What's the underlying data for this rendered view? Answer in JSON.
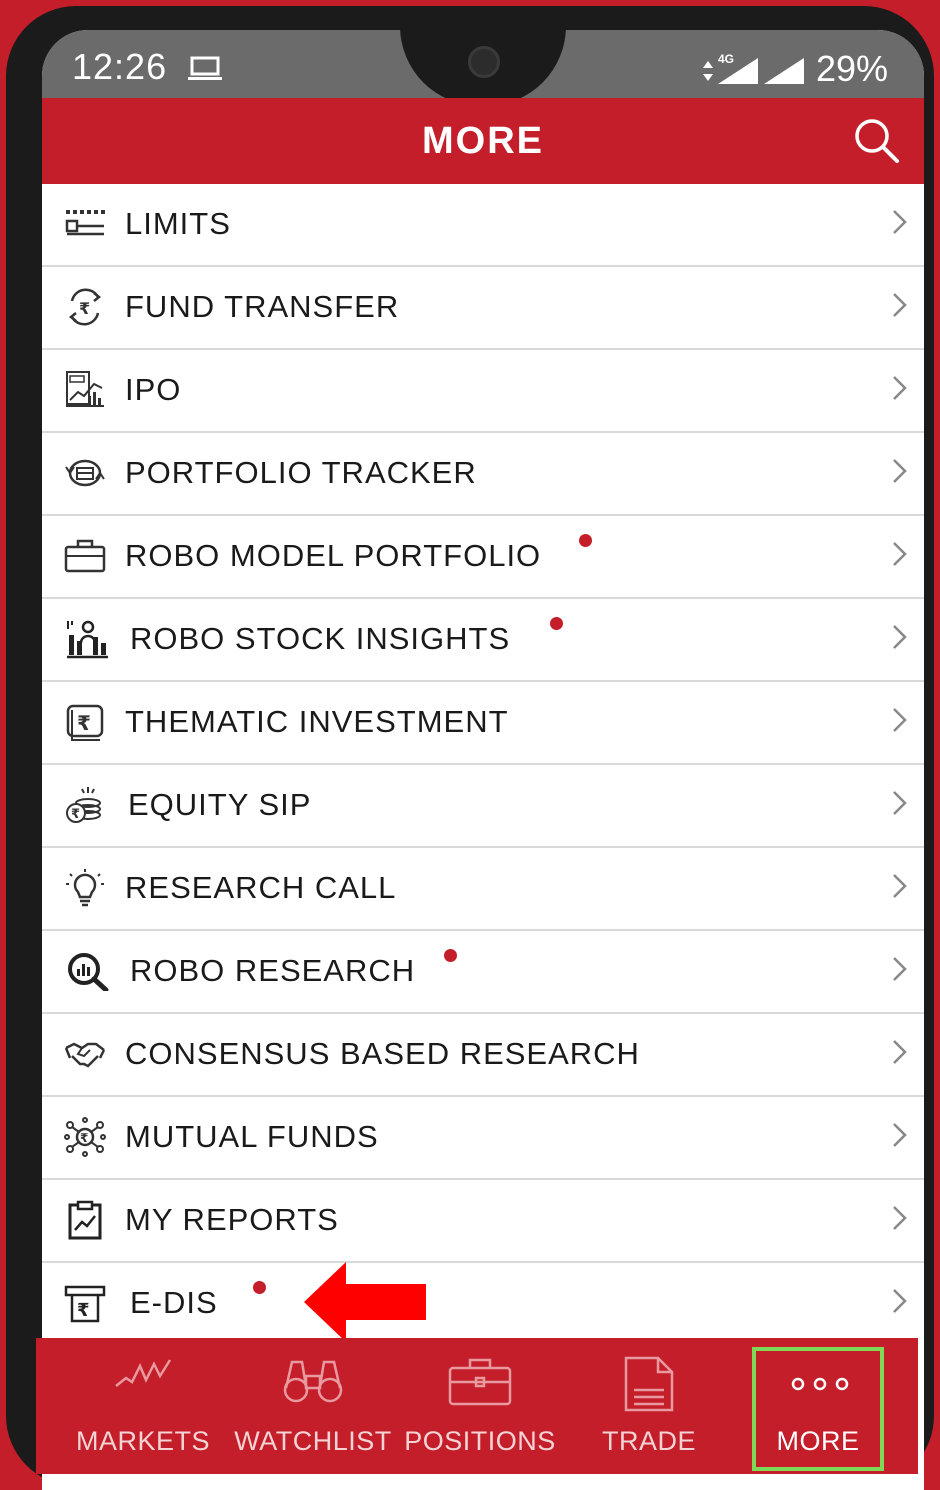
{
  "status_bar": {
    "time": "12:26",
    "network": "4G",
    "battery": "29%"
  },
  "header": {
    "title": "MORE"
  },
  "menu": {
    "items": [
      {
        "label": "LIMITS",
        "icon": "limits-icon",
        "new": false
      },
      {
        "label": "FUND TRANSFER",
        "icon": "fund-transfer-icon",
        "new": false
      },
      {
        "label": "IPO",
        "icon": "ipo-icon",
        "new": false
      },
      {
        "label": "PORTFOLIO TRACKER",
        "icon": "portfolio-tracker-icon",
        "new": false
      },
      {
        "label": "ROBO MODEL PORTFOLIO",
        "icon": "briefcase-icon",
        "new": true
      },
      {
        "label": "ROBO STOCK INSIGHTS",
        "icon": "stock-insights-icon",
        "new": true
      },
      {
        "label": "THEMATIC INVESTMENT",
        "icon": "rupee-note-icon",
        "new": false
      },
      {
        "label": "EQUITY SIP",
        "icon": "coins-icon",
        "new": false
      },
      {
        "label": "RESEARCH CALL",
        "icon": "lightbulb-icon",
        "new": false
      },
      {
        "label": "ROBO RESEARCH",
        "icon": "magnifier-chart-icon",
        "new": true
      },
      {
        "label": "CONSENSUS BASED RESEARCH",
        "icon": "handshake-icon",
        "new": false
      },
      {
        "label": "MUTUAL FUNDS",
        "icon": "network-gear-icon",
        "new": false
      },
      {
        "label": "MY REPORTS",
        "icon": "clipboard-chart-icon",
        "new": false
      },
      {
        "label": "E-DIS",
        "icon": "rupee-receipt-icon",
        "new": true
      }
    ]
  },
  "bottom_nav": {
    "items": [
      {
        "label": "MARKETS",
        "icon": "markets-line-icon"
      },
      {
        "label": "WATCHLIST",
        "icon": "binoculars-icon"
      },
      {
        "label": "POSITIONS",
        "icon": "briefcase-icon"
      },
      {
        "label": "TRADE",
        "icon": "document-icon"
      },
      {
        "label": "MORE",
        "icon": "more-dots-icon"
      }
    ],
    "selected": "MORE"
  },
  "colors": {
    "brand_red": "#c41e2a",
    "highlight_green": "#7ed957",
    "arrow_red": "#ff0000"
  }
}
